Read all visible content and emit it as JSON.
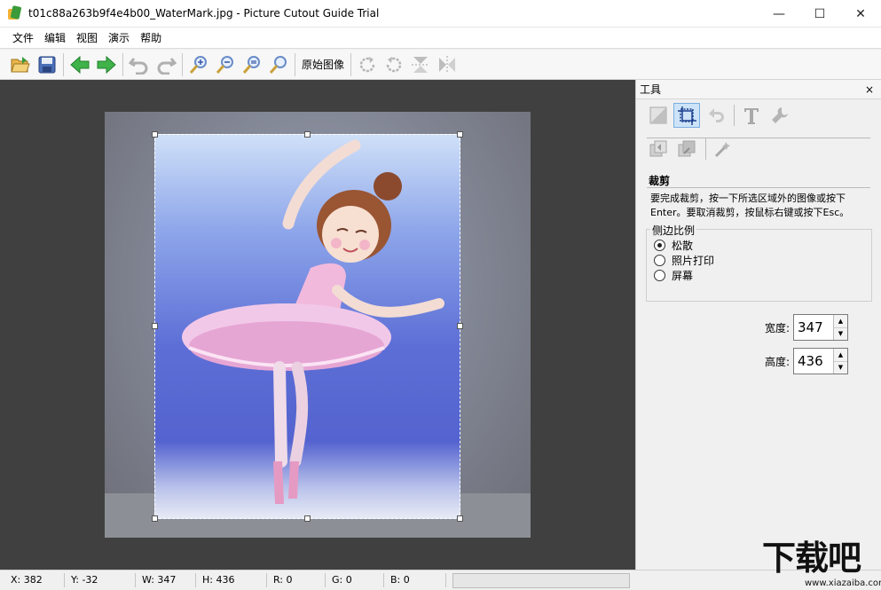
{
  "window": {
    "title": "t01c88a263b9f4e4b00_WaterMark.jpg - Picture Cutout Guide Trial",
    "minimize": "—",
    "maximize": "☐",
    "close": "✕"
  },
  "menu": [
    "文件",
    "编辑",
    "视图",
    "演示",
    "帮助"
  ],
  "toolbar": {
    "original_image_label": "原始图像"
  },
  "panel": {
    "title": "工具",
    "close": "×",
    "section_title": "裁剪",
    "description": "要完成裁剪，按一下所选区域外的图像或按下Enter。要取消裁剪，按鼠标右键或按下Esc。",
    "ratio_group_label": "侧边比例",
    "ratio_options": [
      {
        "label": "松散",
        "checked": true
      },
      {
        "label": "照片打印",
        "checked": false
      },
      {
        "label": "屏幕",
        "checked": false
      }
    ],
    "width_label": "宽度:",
    "width_value": "347",
    "height_label": "高度:",
    "height_value": "436"
  },
  "status": {
    "x": "X: 382",
    "y": "Y: -32",
    "w": "W: 347",
    "h": "H: 436",
    "r": "R: 0",
    "g": "G: 0",
    "b": "B: 0"
  },
  "watermark": {
    "logo_text": "下载吧",
    "url": "www.xiazaiba.com"
  }
}
